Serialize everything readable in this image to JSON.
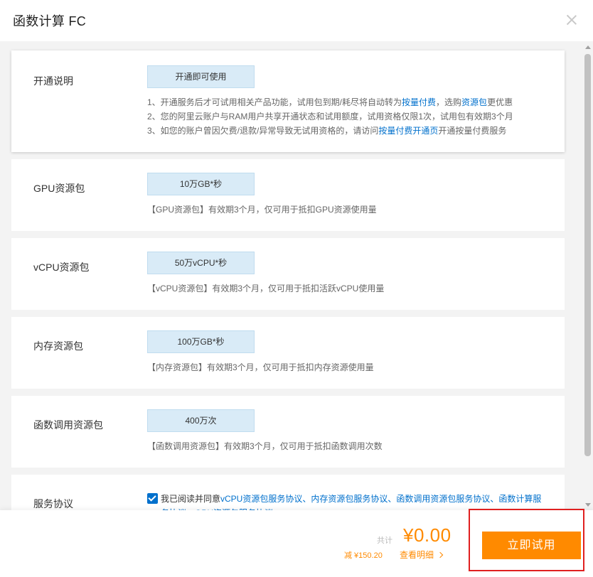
{
  "header": {
    "title": "函数计算 FC"
  },
  "cards": {
    "activation": {
      "label": "开通说明",
      "chip": "开通即可使用",
      "line1_pre": "1、开通服务后才可试用相关产品功能，试用包到期/耗尽将自动转为",
      "line1_link1": "按量付费",
      "line1_mid": "，选购",
      "line1_link2": "资源包",
      "line1_post": "更优惠",
      "line2": "2、您的阿里云账户与RAM用户共享开通状态和试用额度，试用资格仅限1次，试用包有效期3个月",
      "line3_pre": "3、如您的账户曾因欠费/退款/异常导致无试用资格的，请访问",
      "line3_link": "按量付费开通页",
      "line3_post": "开通按量付费服务"
    },
    "gpu": {
      "label": "GPU资源包",
      "chip": "10万GB*秒",
      "desc": "【GPU资源包】有效期3个月，仅可用于抵扣GPU资源使用量"
    },
    "vcpu": {
      "label": "vCPU资源包",
      "chip": "50万vCPU*秒",
      "desc": "【vCPU资源包】有效期3个月，仅可用于抵扣活跃vCPU使用量"
    },
    "memory": {
      "label": "内存资源包",
      "chip": "100万GB*秒",
      "desc": "【内存资源包】有效期3个月，仅可用于抵扣内存资源使用量"
    },
    "invocation": {
      "label": "函数调用资源包",
      "chip": "400万次",
      "desc": "【函数调用资源包】有效期3个月，仅可用于抵扣函数调用次数"
    },
    "agreement": {
      "label": "服务协议",
      "checked": true,
      "text_pre": "我已阅读并同意",
      "links": "vCPU资源包服务协议、内存资源包服务协议、函数调用资源包服务协议、函数计算服务协议、GPU资源包服务协议"
    }
  },
  "footer": {
    "total_label": "共计",
    "total_price": "¥0.00",
    "discount": "减 ¥150.20",
    "details_link": "查看明细",
    "try_button": "立即试用"
  },
  "colors": {
    "accent": "#ff8a00",
    "link": "#0070cc",
    "chip_bg": "#d9ebf7",
    "highlight": "#e02020"
  }
}
